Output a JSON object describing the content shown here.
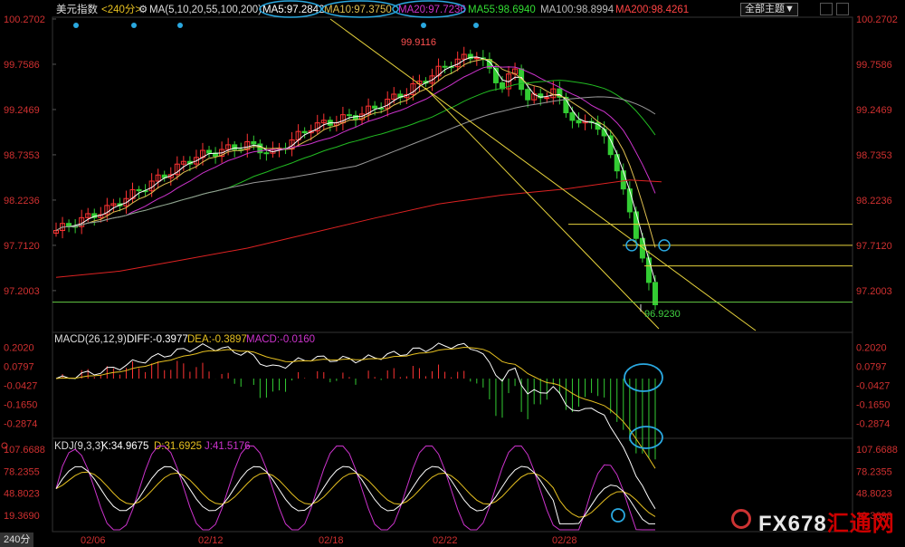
{
  "header": {
    "title": "美元指数",
    "period": "<240分>",
    "ma_text": "MA(5,10,20,55,100,200)",
    "ma5": "MA5:97.2842",
    "ma10": "MA10:97.3750",
    "ma20": "MA20:97.7236",
    "ma55": "MA55:98.6940",
    "ma100": "MA100:98.8994",
    "ma200": "MA200:98.4261",
    "theme_button": "全部主题▼"
  },
  "colors": {
    "up": "#ff3333",
    "down": "#33cc33",
    "ma5": "#ffffff",
    "ma10": "#e0c050",
    "ma20": "#cc33cc",
    "ma55": "#22bb22",
    "ma100": "#999999",
    "ma200": "#dd2222",
    "channel": "#e6d23c",
    "hline_green": "#66cc44",
    "highlight": "#2aa8e0"
  },
  "chart_data": [
    {
      "type": "candlestick",
      "title": "美元指数 240分",
      "y_ticks": [
        "100.2702",
        "99.7586",
        "99.2469",
        "98.7353",
        "98.2236",
        "97.7120",
        "97.2003"
      ],
      "ylim": [
        96.8,
        100.27
      ],
      "x_ticks": [
        "02/06",
        "02/12",
        "02/18",
        "02/22",
        "02/28"
      ],
      "annotations": {
        "high": "99.9116",
        "low": "96.9230"
      },
      "horizontal_levels": [
        97.95,
        97.712,
        97.48,
        97.07
      ],
      "moving_averages": [
        "MA5",
        "MA10",
        "MA20",
        "MA55",
        "MA100",
        "MA200"
      ],
      "ma200_path": [
        [
          0,
          97.35
        ],
        [
          10,
          97.42
        ],
        [
          20,
          97.55
        ],
        [
          30,
          97.68
        ],
        [
          40,
          97.85
        ],
        [
          50,
          98.02
        ],
        [
          60,
          98.18
        ],
        [
          70,
          98.28
        ],
        [
          80,
          98.35
        ],
        [
          90,
          98.45
        ],
        [
          95,
          98.43
        ]
      ]
    },
    {
      "type": "line",
      "title": "MACD(26,12,9)",
      "legend": [
        "DIFF:-0.3977",
        "DEA:-0.3897",
        "MACD:-0.0160"
      ],
      "y_ticks": [
        "0.2020",
        "0.0797",
        "-0.0427",
        "-0.1650",
        "-0.2874"
      ],
      "ylim": [
        -0.36,
        0.25
      ]
    },
    {
      "type": "line",
      "title": "KDJ(9,3,3)",
      "legend": [
        "K:34.9675",
        "D:31.6925",
        "J:41.5176"
      ],
      "y_ticks": [
        "107.6688",
        "78.2355",
        "48.8023",
        "19.3690"
      ],
      "ylim": [
        0,
        115
      ]
    }
  ],
  "footer": {
    "period_label": "240分",
    "logo": "FX678",
    "logo_cn": "汇通网"
  }
}
